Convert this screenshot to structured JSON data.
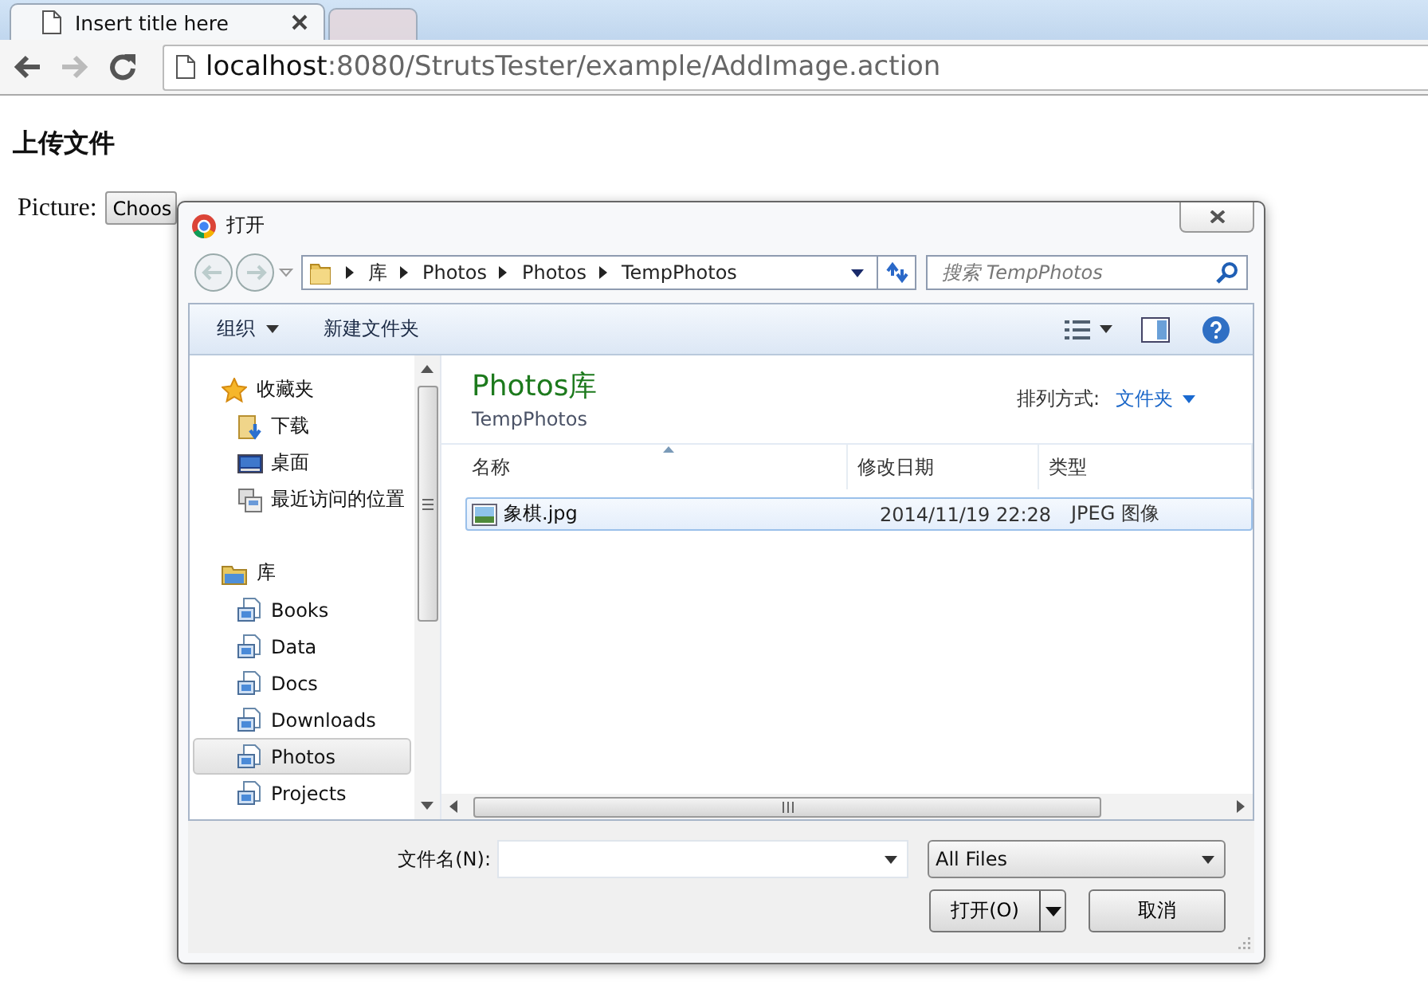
{
  "browser": {
    "tabs": [
      {
        "title": "Insert title here",
        "selected": true
      },
      {
        "selected": false
      }
    ],
    "address": {
      "host": "localhost",
      "path": ":8080/StrutsTester/example/AddImage.action"
    }
  },
  "page": {
    "heading": "上传文件",
    "field_label": "Picture:",
    "choose_button": "Choos"
  },
  "dialog": {
    "title": "打开",
    "breadcrumb": [
      "库",
      "Photos",
      "Photos",
      "TempPhotos"
    ],
    "search_placeholder": "搜索 TempPhotos",
    "toolbar": [
      {
        "label": "组织",
        "menu": true
      },
      {
        "label": "新建文件夹",
        "menu": false
      }
    ],
    "nav": [
      {
        "label": "收藏夹",
        "kind": "star",
        "selected": false,
        "children": [
          {
            "label": "下载",
            "kind": "download",
            "selected": false
          },
          {
            "label": "桌面",
            "kind": "desktop",
            "selected": false
          },
          {
            "label": "最近访问的位置",
            "kind": "recent",
            "selected": false
          }
        ]
      },
      {
        "label": "库",
        "kind": "library",
        "selected": false,
        "children": [
          {
            "label": "Books",
            "kind": "lib",
            "selected": false
          },
          {
            "label": "Data",
            "kind": "lib",
            "selected": false
          },
          {
            "label": "Docs",
            "kind": "lib",
            "selected": false
          },
          {
            "label": "Downloads",
            "kind": "lib",
            "selected": false
          },
          {
            "label": "Photos",
            "kind": "lib",
            "selected": true
          },
          {
            "label": "Projects",
            "kind": "lib",
            "selected": false
          }
        ]
      }
    ],
    "library": {
      "title": "Photos库",
      "subtitle": "TempPhotos",
      "arrange_label": "排列方式:",
      "arrange_value": "文件夹"
    },
    "columns": [
      "名称",
      "修改日期",
      "类型"
    ],
    "files": [
      {
        "name": "象棋.jpg",
        "modified": "2014/11/19 22:28",
        "type": "JPEG 图像",
        "selected": true
      }
    ],
    "filename_label": "文件名(N):",
    "filter": "All Files",
    "buttons": [
      {
        "label": "打开(O)",
        "split": true
      },
      {
        "label": "取消",
        "split": false
      }
    ]
  }
}
